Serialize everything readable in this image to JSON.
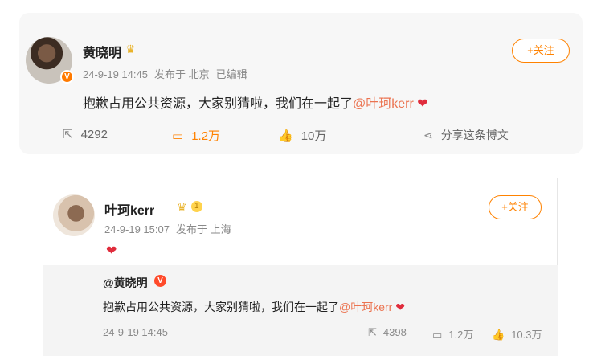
{
  "post1": {
    "author": "黄晓明",
    "crown_icon": "crown-icon",
    "timestamp": "24-9-19 14:45",
    "location": "发布于 北京",
    "edited": "已编辑",
    "follow_label": "+关注",
    "text": "抱歉占用公共资源，大家别猜啦，我们在一起了",
    "mention": "@叶珂kerr",
    "heart": "❤",
    "actions": {
      "repost_count": "4292",
      "comment_count": "1.2万",
      "like_count": "10万",
      "share_label": "分享这条博文"
    },
    "accent_color": "#ff8200"
  },
  "post2": {
    "author": "叶珂kerr",
    "vip_level": "1",
    "timestamp": "24-9-19 15:07",
    "location": "发布于 上海",
    "follow_label": "+关注",
    "text": "❤",
    "quoted": {
      "author": "@黄晓明",
      "badge": "V",
      "text": "抱歉占用公共资源，大家别猜啦，我们在一起了",
      "mention": "@叶珂kerr",
      "heart": "❤",
      "timestamp": "24-9-19 14:45",
      "repost_count": "4398",
      "comment_count": "1.2万",
      "like_count": "10.3万"
    }
  }
}
